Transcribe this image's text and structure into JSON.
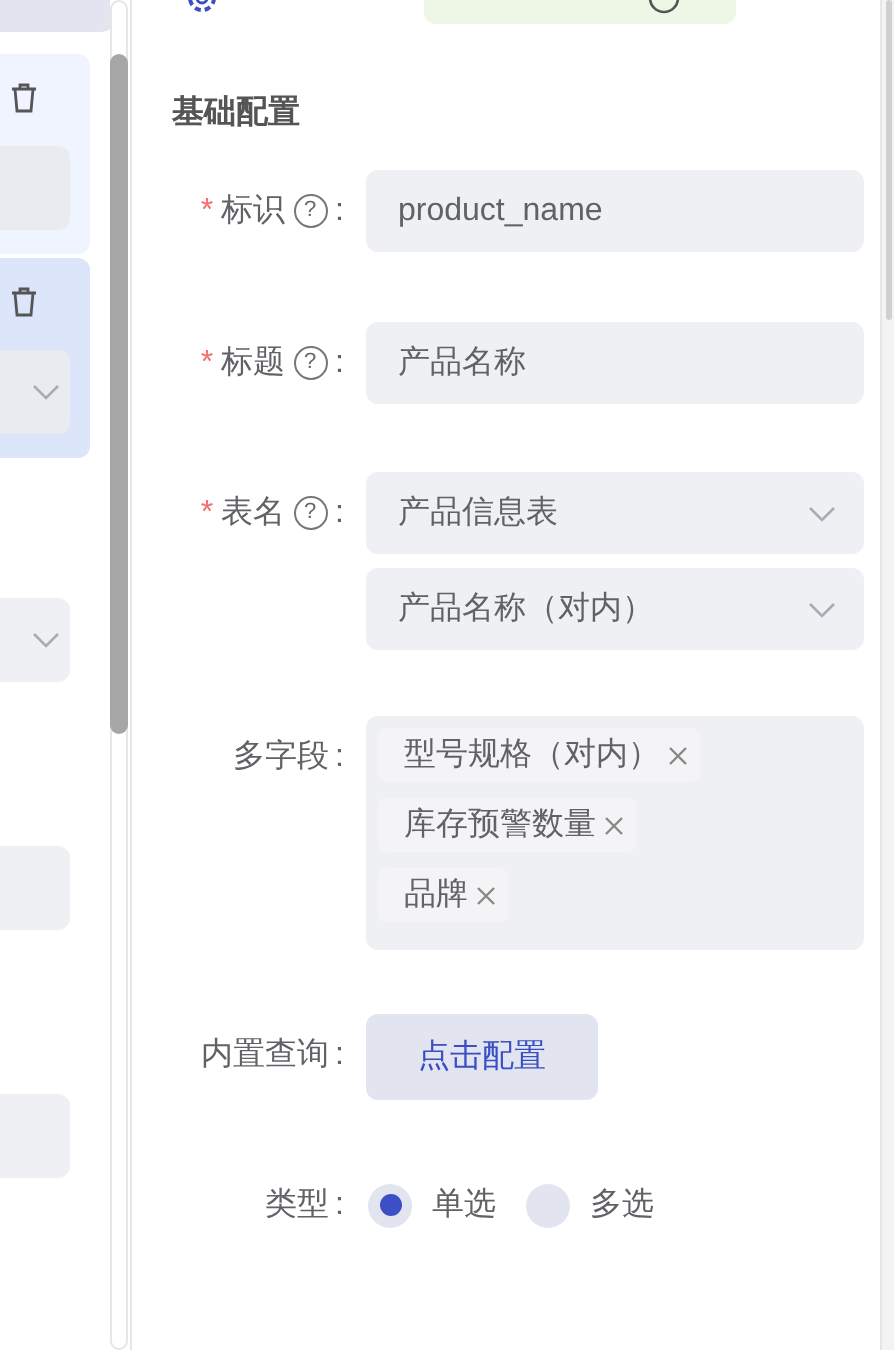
{
  "left_panel": {
    "cards": [
      {
        "selected": false,
        "fields": [
          {
            "kind": "input"
          }
        ]
      },
      {
        "selected": true,
        "fields": [
          {
            "kind": "select"
          }
        ]
      }
    ],
    "fields": [
      {
        "kind": "select"
      },
      {
        "kind": "input"
      },
      {
        "kind": "input"
      }
    ]
  },
  "section_title": "基础配置",
  "form": [
    {
      "kind": "input",
      "label": "标识",
      "required_mark": "*",
      "help": "?",
      "colon": ":",
      "value": "product_name"
    },
    {
      "kind": "input",
      "label": "标题",
      "required_mark": "*",
      "help": "?",
      "colon": ":",
      "value": "产品名称"
    },
    {
      "kind": "selects",
      "label": "表名",
      "required_mark": "*",
      "help": "?",
      "colon": ":",
      "values": [
        "产品信息表",
        "产品名称（对内）"
      ]
    },
    {
      "kind": "tags",
      "label": "多字段",
      "colon": ":",
      "tags": [
        "型号规格（对内）",
        "库存预警数量",
        "品牌"
      ]
    },
    {
      "kind": "button",
      "label": "内置查询",
      "colon": ":",
      "button": "点击配置"
    },
    {
      "kind": "radio",
      "label": "类型",
      "colon": ":",
      "options": [
        {
          "label": "单选",
          "selected": true
        },
        {
          "label": "多选",
          "selected": false
        }
      ]
    }
  ]
}
